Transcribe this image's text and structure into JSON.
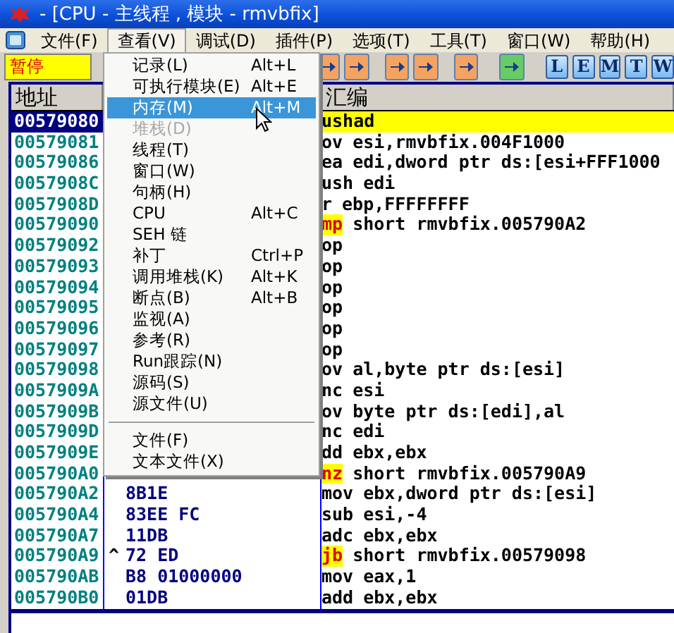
{
  "window": {
    "title": "- [CPU - 主线程 , 模块 - rmvbfix]"
  },
  "menubar": [
    {
      "label": "文件(F)",
      "selected": false
    },
    {
      "label": "查看(V)",
      "selected": true
    },
    {
      "label": "调试(D)",
      "selected": false
    },
    {
      "label": "插件(P)",
      "selected": false
    },
    {
      "label": "选项(T)",
      "selected": false
    },
    {
      "label": "工具(T)",
      "selected": false
    },
    {
      "label": "窗口(W)",
      "selected": false
    },
    {
      "label": "帮助(H)",
      "selected": false
    }
  ],
  "toolbar": {
    "status": "暂停",
    "buttons": [
      {
        "kind": "icon",
        "color": "#f4a460"
      },
      {
        "kind": "icon",
        "color": "#f4a460"
      },
      {
        "kind": "icon",
        "color": "#f4a460"
      },
      {
        "kind": "icon",
        "color": "#f4a460"
      },
      {
        "kind": "icon",
        "color": "#f4a460"
      },
      {
        "kind": "icon",
        "color": "#66cc66"
      },
      {
        "kind": "letter",
        "label": "L"
      },
      {
        "kind": "letter",
        "label": "E"
      },
      {
        "kind": "letter",
        "label": "M"
      },
      {
        "kind": "letter",
        "label": "T"
      },
      {
        "kind": "letter",
        "label": "W"
      }
    ]
  },
  "dropdown_menu": {
    "items": [
      {
        "kind": "item",
        "label": "记录(L)",
        "shortcut": "Alt+L",
        "selected": false,
        "disabled": false
      },
      {
        "kind": "item",
        "label": "可执行模块(E)",
        "shortcut": "Alt+E",
        "selected": false,
        "disabled": false
      },
      {
        "kind": "item",
        "label": "内存(M)",
        "shortcut": "Alt+M",
        "selected": true,
        "disabled": false
      },
      {
        "kind": "item",
        "label": "堆栈(D)",
        "selected": false,
        "disabled": true
      },
      {
        "kind": "item",
        "label": "线程(T)",
        "selected": false,
        "disabled": false
      },
      {
        "kind": "item",
        "label": "窗口(W)",
        "selected": false,
        "disabled": false
      },
      {
        "kind": "item",
        "label": "句柄(H)",
        "selected": false,
        "disabled": false
      },
      {
        "kind": "item",
        "label": "CPU",
        "shortcut": "Alt+C",
        "selected": false,
        "disabled": false
      },
      {
        "kind": "item",
        "label": "SEH 链",
        "selected": false,
        "disabled": false
      },
      {
        "kind": "item",
        "label": "补丁",
        "shortcut": "Ctrl+P",
        "selected": false,
        "disabled": false
      },
      {
        "kind": "item",
        "label": "调用堆栈(K)",
        "shortcut": "Alt+K",
        "selected": false,
        "disabled": false
      },
      {
        "kind": "item",
        "label": "断点(B)",
        "shortcut": "Alt+B",
        "selected": false,
        "disabled": false
      },
      {
        "kind": "item",
        "label": "监视(A)",
        "selected": false,
        "disabled": false
      },
      {
        "kind": "item",
        "label": "参考(R)",
        "selected": false,
        "disabled": false
      },
      {
        "kind": "item",
        "label": "Run跟踪(N)",
        "selected": false,
        "disabled": false
      },
      {
        "kind": "item",
        "label": "源码(S)",
        "selected": false,
        "disabled": false
      },
      {
        "kind": "item",
        "label": "源文件(U)",
        "selected": false,
        "disabled": false
      },
      {
        "kind": "separator"
      },
      {
        "kind": "item",
        "label": "文件(F)",
        "selected": false,
        "disabled": false
      },
      {
        "kind": "item",
        "label": "文本文件(X)",
        "selected": false,
        "disabled": false
      }
    ]
  },
  "cpu_pane": {
    "columns": [
      "地址",
      "汇编"
    ],
    "rows": [
      {
        "address": "00579080",
        "selected": true,
        "mnemonic": "ushad",
        "jump": false
      },
      {
        "address": "00579081",
        "selected": false,
        "mnemonic": "ov",
        "operands": "esi,rmvbfix.004F1000",
        "jump": false
      },
      {
        "address": "00579086",
        "selected": false,
        "mnemonic": "ea",
        "operands": "edi,dword ptr ds:[esi+FFF1000",
        "jump": false
      },
      {
        "address": "0057908C",
        "selected": false,
        "mnemonic": "ush",
        "operands": "edi",
        "jump": false
      },
      {
        "address": "0057908D",
        "selected": false,
        "mnemonic": "r",
        "operands": "ebp,FFFFFFFF",
        "jump": false
      },
      {
        "address": "00579090",
        "selected": false,
        "mnemonic": "mp",
        "operands": "short rmvbfix.005790A2",
        "jump": true
      },
      {
        "address": "00579092",
        "selected": false,
        "mnemonic": "op",
        "jump": false
      },
      {
        "address": "00579093",
        "selected": false,
        "mnemonic": "op",
        "jump": false
      },
      {
        "address": "00579094",
        "selected": false,
        "mnemonic": "op",
        "jump": false
      },
      {
        "address": "00579095",
        "selected": false,
        "mnemonic": "op",
        "jump": false
      },
      {
        "address": "00579096",
        "selected": false,
        "mnemonic": "op",
        "jump": false
      },
      {
        "address": "00579097",
        "selected": false,
        "mnemonic": "op",
        "jump": false
      },
      {
        "address": "00579098",
        "selected": false,
        "mnemonic": "ov",
        "operands": "al,byte ptr ds:[esi]",
        "jump": false
      },
      {
        "address": "0057909A",
        "selected": false,
        "mnemonic": "nc",
        "operands": "esi",
        "jump": false
      },
      {
        "address": "0057909B",
        "selected": false,
        "mnemonic": "ov",
        "operands": "byte ptr ds:[edi],al",
        "jump": false
      },
      {
        "address": "0057909D",
        "selected": false,
        "mnemonic": "nc",
        "operands": "edi",
        "jump": false
      },
      {
        "address": "0057909E",
        "selected": false,
        "mnemonic": "dd",
        "operands": "ebx,ebx",
        "jump": false
      },
      {
        "address": "005790A0",
        "selected": false,
        "mnemonic": "nz",
        "operands": "short rmvbfix.005790A9",
        "jump": true
      },
      {
        "address": "005790A2",
        "selected": false,
        "hex": "8B1E",
        "mnemonic": "mov",
        "operands": "ebx,dword ptr ds:[esi]",
        "jump": false
      },
      {
        "address": "005790A4",
        "selected": false,
        "hex": "83EE FC",
        "mnemonic": "sub",
        "operands": "esi,-4",
        "jump": false
      },
      {
        "address": "005790A7",
        "selected": false,
        "hex": "11DB",
        "mnemonic": "adc",
        "operands": "ebx,ebx",
        "jump": false
      },
      {
        "address": "005790A9",
        "selected": false,
        "mark": "^",
        "hex": "72 ED",
        "mnemonic": "jb",
        "operands": "short rmvbfix.00579098",
        "jump": true
      },
      {
        "address": "005790AB",
        "selected": false,
        "hex": "B8 01000000",
        "mnemonic": "mov",
        "operands": "eax,1",
        "jump": false
      },
      {
        "address": "005790B0",
        "selected": false,
        "hex": "01DB",
        "mnemonic": "add",
        "operands": "ebx,ebx",
        "jump": false
      }
    ]
  }
}
